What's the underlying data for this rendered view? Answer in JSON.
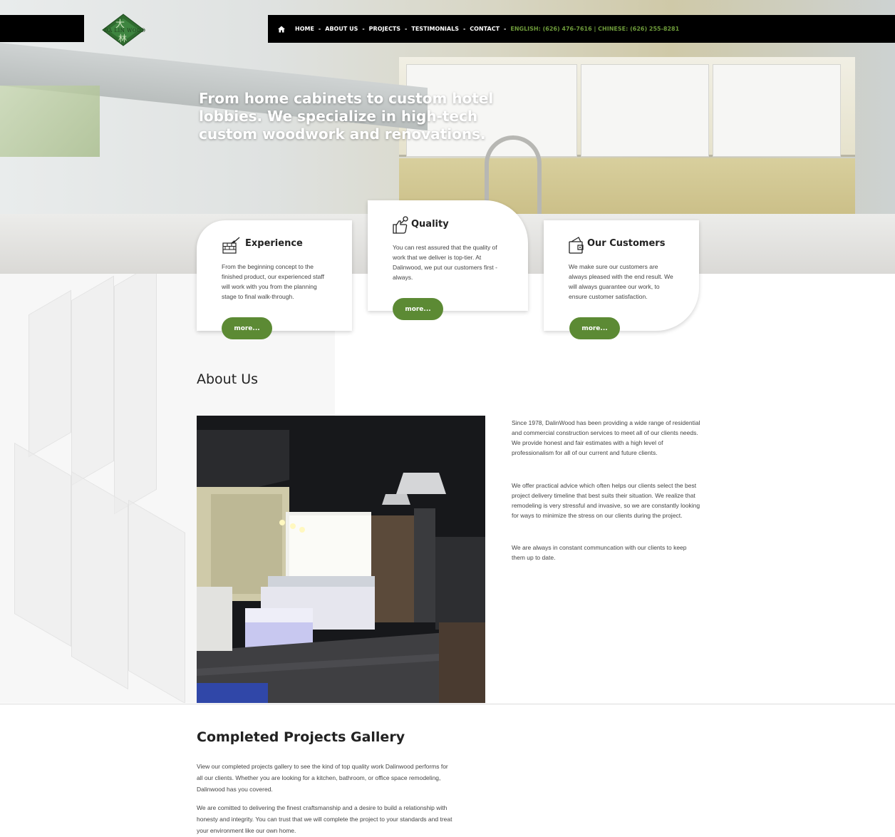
{
  "header": {
    "logo": {
      "text": "DA LIN WOOD"
    },
    "nav": {
      "items": [
        "HOME",
        "ABOUT US",
        "PROJECTS",
        "TESTIMONIALS",
        "CONTACT"
      ],
      "separator": "-",
      "phone": "ENGLISH: (626) 476-7616 | CHINESE: (626) 255-8281",
      "home_icon": "home-icon"
    }
  },
  "hero": {
    "headline": "From home cabinets to custom hotel lobbies. We specialize in high-tech custom woodwork and renovations."
  },
  "cards": [
    {
      "title": "Experience",
      "icon": "brick-wall-trowel-icon",
      "body": "From the beginning concept to the finished product, our experienced staff will work with you from the planning stage to final walk-through.",
      "button": "more..."
    },
    {
      "title": "Quality",
      "icon": "thumbs-up-wrench-icon",
      "body": "You can rest assured that the quality of work that we deliver is top-tier. At Dalinwood, we put our customers first - always.",
      "button": "more..."
    },
    {
      "title": "Our Customers",
      "icon": "wallet-icon",
      "body": "We make sure our customers are always pleased with the end result. We will always guarantee our work, to ensure customer satisfaction.",
      "button": "more..."
    }
  ],
  "about": {
    "title": "About Us",
    "paragraphs": [
      "Since 1978, DalinWood has been providing a wide range of residential and commercial construction services to meet all of our clients needs. We provide honest and fair estimates with a high level of professionalism for all of our current and future clients.",
      "We offer practical advice which often helps our clients select the best project delivery timeline that best suits their situation. We realize that remodeling is very stressful and invasive, so we are constantly looking for ways to minimize the stress on our clients during the project.",
      "We are always in constant communcation with our clients to keep them up to date."
    ]
  },
  "gallery": {
    "title": "Completed Projects Gallery",
    "paragraphs": [
      "View our completed projects gallery to see the kind of top quality work Dalinwood performs for all our clients. Whether you are looking for a kitchen, bathroom, or office space remodeling, Dalinwood has you covered.",
      "We are comitted to delivering the finest craftsmanship and a desire to build a relationship with honesty and integrity. You can trust that we will complete the project to your standards and treat your environment like our own home."
    ]
  },
  "colors": {
    "accent": "#5c8a34",
    "phone": "#6d9a3a",
    "nav_bg": "#000000"
  }
}
